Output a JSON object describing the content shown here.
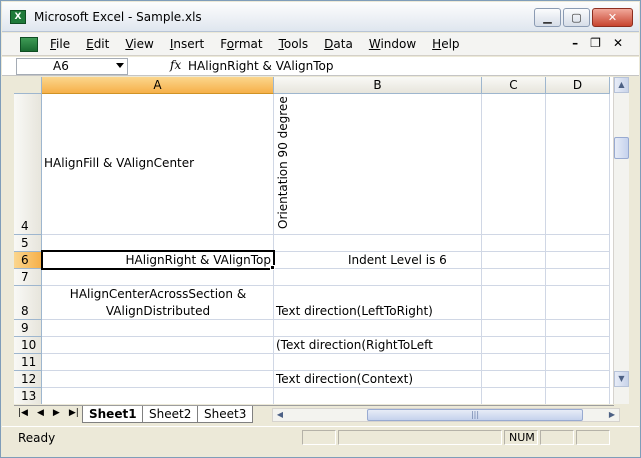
{
  "window": {
    "title": "Microsoft Excel - Sample.xls",
    "app_icon_glyph": "X"
  },
  "menu": {
    "items": [
      {
        "label": "File",
        "u": "F",
        "rest": "ile"
      },
      {
        "label": "Edit",
        "u": "E",
        "rest": "dit"
      },
      {
        "label": "View",
        "u": "V",
        "rest": "iew"
      },
      {
        "label": "Insert",
        "u": "I",
        "rest": "nsert"
      },
      {
        "label": "Format",
        "u": "o",
        "pre": "F",
        "rest": "rmat"
      },
      {
        "label": "Tools",
        "u": "T",
        "rest": "ools"
      },
      {
        "label": "Data",
        "u": "D",
        "rest": "ata"
      },
      {
        "label": "Window",
        "u": "W",
        "rest": "indow"
      },
      {
        "label": "Help",
        "u": "H",
        "rest": "elp"
      }
    ]
  },
  "formula_bar": {
    "name_box": "A6",
    "fx": "fx",
    "formula": "HAlignRight & VAlignTop"
  },
  "columns": [
    "A",
    "B",
    "C",
    "D"
  ],
  "rows": [
    "4",
    "5",
    "6",
    "7",
    "8",
    "9",
    "10",
    "11",
    "12",
    "13"
  ],
  "cells": {
    "A4": "HAlignFill & VAlignCenter",
    "B4": "Orientation 90 degree",
    "A6": "HAlignRight & VAlignTop",
    "B6": "Indent Level is 6",
    "A8_line1": "HAlignCenterAcrossSection &",
    "A8_line2": "VAlignDistributed",
    "B8": "Text direction(LeftToRight)",
    "B10": "(Text direction(RightToLeft",
    "B12": "Text direction(Context)"
  },
  "sheets": [
    "Sheet1",
    "Sheet2",
    "Sheet3"
  ],
  "active_sheet": "Sheet1",
  "status": {
    "ready": "Ready",
    "num": "NUM"
  },
  "colors": {
    "active_header": "#F6B04A",
    "grid_line": "#D0D7E5",
    "chrome": "#ECE9D8"
  }
}
